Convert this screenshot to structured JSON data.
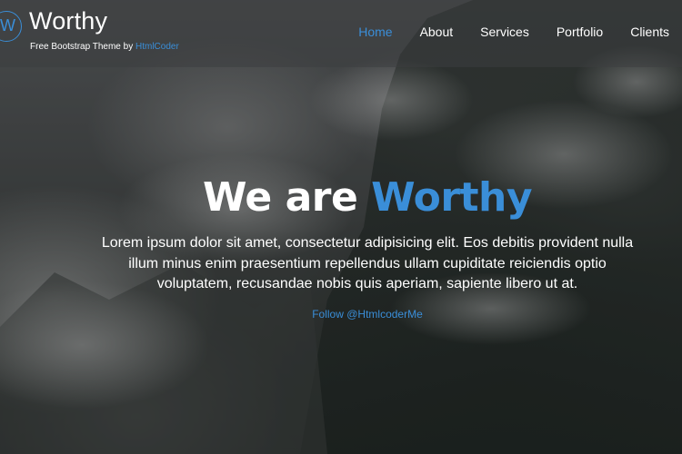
{
  "header": {
    "logo_letter": "W",
    "site_name": "Worthy",
    "tagline_prefix": "Free Bootstrap Theme by ",
    "tagline_link": "HtmlCoder"
  },
  "nav": {
    "items": [
      {
        "label": "Home",
        "active": true
      },
      {
        "label": "About",
        "active": false
      },
      {
        "label": "Services",
        "active": false
      },
      {
        "label": "Portfolio",
        "active": false
      },
      {
        "label": "Clients",
        "active": false
      }
    ]
  },
  "hero": {
    "headline_prefix": "We are ",
    "headline_accent": "Worthy",
    "lead": "Lorem ipsum dolor sit amet, consectetur adipisicing elit. Eos debitis provident nulla illum minus enim praesentium repellendus ullam cupiditate reiciendis optio voluptatem, recusandae nobis quis aperiam, sapiente libero ut at.",
    "follow_link": "Follow @HtmlcoderMe"
  },
  "colors": {
    "accent": "#3a8ed8",
    "text": "#ffffff"
  }
}
